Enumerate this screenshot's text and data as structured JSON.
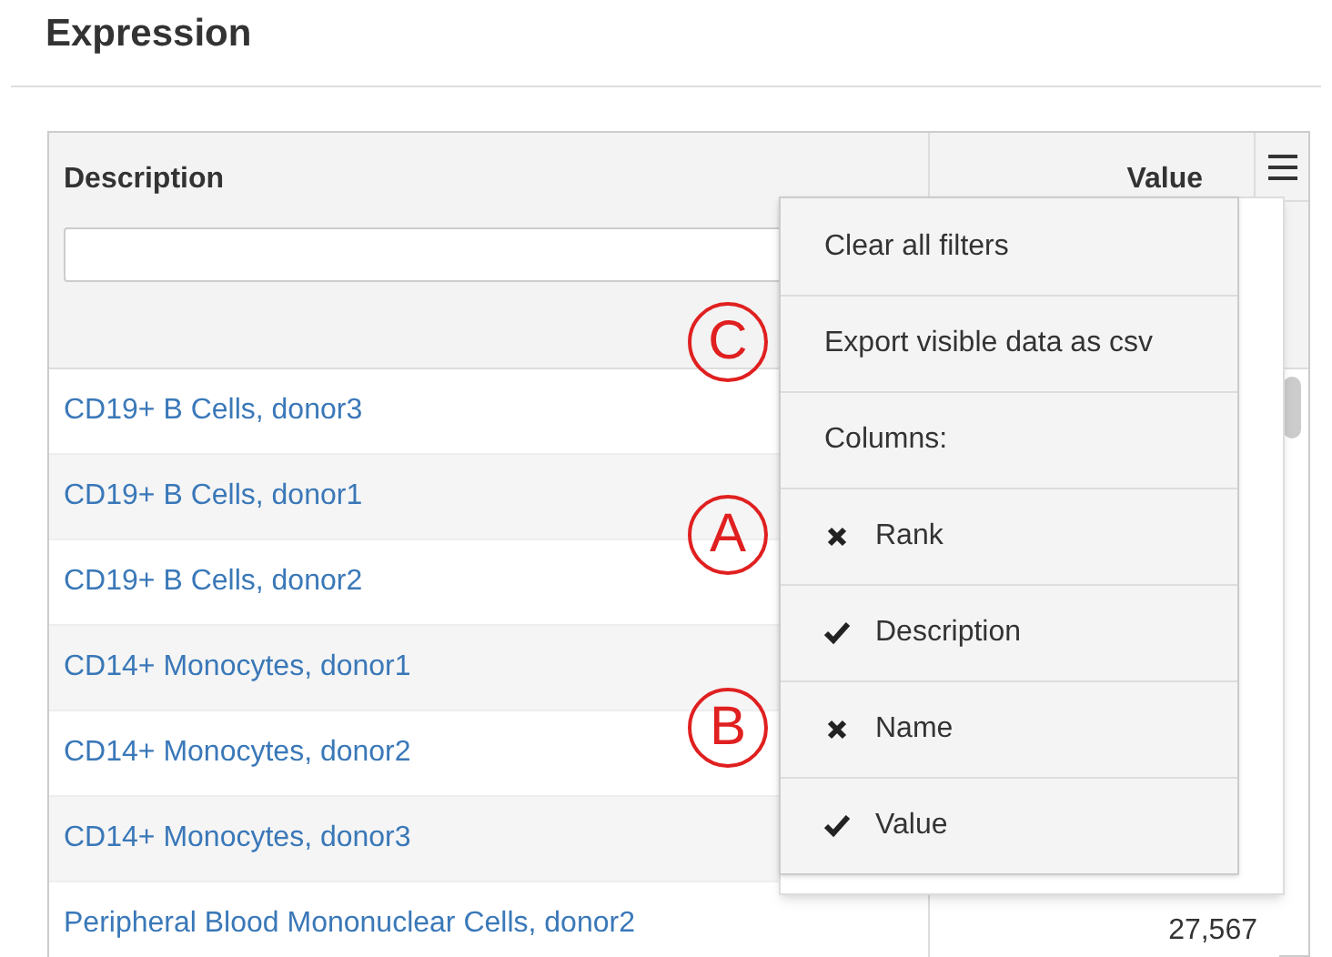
{
  "section_title": "Expression",
  "table": {
    "columns": [
      {
        "label": "Description"
      },
      {
        "label": "Value"
      }
    ],
    "rows": [
      {
        "description": "CD19+ B Cells, donor3"
      },
      {
        "description": "CD19+ B Cells, donor1"
      },
      {
        "description": "CD19+ B Cells, donor2"
      },
      {
        "description": "CD14+ Monocytes, donor1"
      },
      {
        "description": "CD14+ Monocytes, donor2"
      },
      {
        "description": "CD14+ Monocytes, donor3"
      },
      {
        "description": "Peripheral Blood Mononuclear Cells, donor2",
        "value": "27,567"
      }
    ]
  },
  "menu": {
    "items": [
      {
        "kind": "action",
        "label": "Clear all filters"
      },
      {
        "kind": "action",
        "label": "Export visible data as csv",
        "annotation": "C"
      },
      {
        "kind": "heading",
        "label": "Columns:"
      },
      {
        "kind": "toggle",
        "label": "Rank",
        "checked": false,
        "annotation": "A"
      },
      {
        "kind": "toggle",
        "label": "Description",
        "checked": true
      },
      {
        "kind": "toggle",
        "label": "Name",
        "checked": false,
        "annotation": "B"
      },
      {
        "kind": "toggle",
        "label": "Value",
        "checked": true
      }
    ]
  }
}
